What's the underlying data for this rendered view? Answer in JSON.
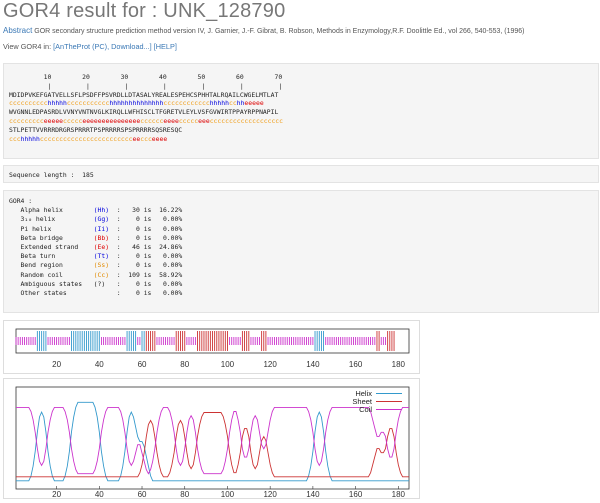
{
  "page": {
    "title": "GOR4 result for : UNK_128790",
    "abstract_link": "Abstract",
    "abstract_text": " GOR secondary structure prediction method version IV, J. Garnier, J.-F. Gibrat, B. Robson, Methods in Enzymology,R.F. Doolittle Ed., vol 266, 540-553, (1996)",
    "view_prefix": "View GOR4 in: ",
    "view_links": [
      "[AnTheProt (PC)",
      ", Download...]",
      "[HELP]"
    ]
  },
  "sequence_panel": {
    "ruler_numbers": "         10        20        30        40        50        60        70",
    "ruler_ticks": "          |         |         |         |         |         |         |",
    "lines": [
      "MDIDPVKEFGATVELLSFLPSDFFPSVRDLLDTASALYREALESPEHCSPHHTALRQAILCWGELMTLAT",
      "cccccccccchhhhhccccccccccchhhhhhhhhhhhhhcccccccccccchhhhhcchheeeee",
      "WVGNNLEDPASRDLVVNYVNTNVGLKIRQLLWFHISCLTFGRETVLEYLVSFGVWIRTPPAYRPPNAPIL",
      "ccccccccceeeeeccccceeeeeeeeeeeeeeecccccceeeeccccceeeccccccccccccccccccc",
      "STLPETTVVRRRDRGRSPRRRTPSPRRRRSPSPRRRRSQSRESQC",
      "ccchhhhhcccccccccccccccccccccccceeccceeee"
    ]
  },
  "sequence_length": {
    "label": "Sequence length :",
    "value": "185"
  },
  "gor4": {
    "header": "GOR4 :",
    "rows": [
      {
        "name": "Alpha helix",
        "code": "(Hh)",
        "count": "30",
        "pct": "16.22%"
      },
      {
        "name": "3₁₀ helix",
        "code": "(Gg)",
        "count": "0",
        "pct": "0.00%"
      },
      {
        "name": "Pi helix",
        "code": "(Ii)",
        "count": "0",
        "pct": "0.00%"
      },
      {
        "name": "Beta bridge",
        "code": "(Bb)",
        "count": "0",
        "pct": "0.00%"
      },
      {
        "name": "Extended strand",
        "code": "(Ee)",
        "count": "46",
        "pct": "24.86%"
      },
      {
        "name": "Beta turn",
        "code": "(Tt)",
        "count": "0",
        "pct": "0.00%"
      },
      {
        "name": "Bend region",
        "code": "(Ss)",
        "count": "0",
        "pct": "0.00%"
      },
      {
        "name": "Random coil",
        "code": "(Cc)",
        "count": "109",
        "pct": "58.92%"
      },
      {
        "name": "Ambiguous states",
        "code": "(?)",
        "count": "0",
        "pct": "0.00%"
      },
      {
        "name": "Other states",
        "code": "",
        "count": "0",
        "pct": "0.00%"
      }
    ]
  },
  "colors": {
    "helix": "#3399cc",
    "sheet": "#cc3333",
    "coil": "#cc33cc",
    "link": "#3a78b5"
  },
  "chart_data": [
    {
      "type": "bar",
      "x_ticks": [
        20,
        40,
        60,
        80,
        100,
        120,
        140,
        160,
        180
      ],
      "xlim": [
        1,
        185
      ]
    },
    {
      "type": "line",
      "x_ticks": [
        20,
        40,
        60,
        80,
        100,
        120,
        140,
        160,
        180
      ],
      "xlim": [
        1,
        185
      ],
      "ylim": [
        0,
        1
      ],
      "legend_position": "top-right",
      "series": [
        {
          "name": "Helix",
          "color": "#3399cc"
        },
        {
          "name": "Sheet",
          "color": "#cc3333"
        },
        {
          "name": "Coil",
          "color": "#cc33cc"
        }
      ]
    }
  ]
}
